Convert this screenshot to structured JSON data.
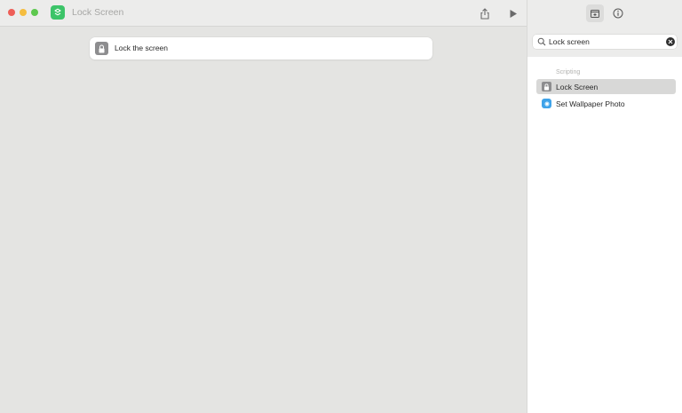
{
  "window": {
    "title": "Lock Screen",
    "colors": {
      "app_icon": "#3cc468",
      "traffic_red": "#ee5e57",
      "traffic_yellow": "#f5bd3f",
      "traffic_green": "#5dc84e"
    }
  },
  "toolbar": {
    "share_icon": "share-icon",
    "run_icon": "play-icon"
  },
  "editor": {
    "action": {
      "label": "Lock the screen",
      "icon": "lock-icon"
    }
  },
  "sidebar": {
    "tabs": [
      {
        "name": "library",
        "icon": "action-library-icon",
        "selected": true
      },
      {
        "name": "info",
        "icon": "info-icon",
        "selected": false
      }
    ],
    "search": {
      "value": "Lock screen",
      "placeholder": "Search for apps and actions"
    },
    "section": "Scripting",
    "results": [
      {
        "label": "Lock Screen",
        "icon": "lock-icon",
        "selected": true
      },
      {
        "label": "Set Wallpaper Photo",
        "icon": "wallpaper-icon",
        "selected": false
      }
    ]
  }
}
